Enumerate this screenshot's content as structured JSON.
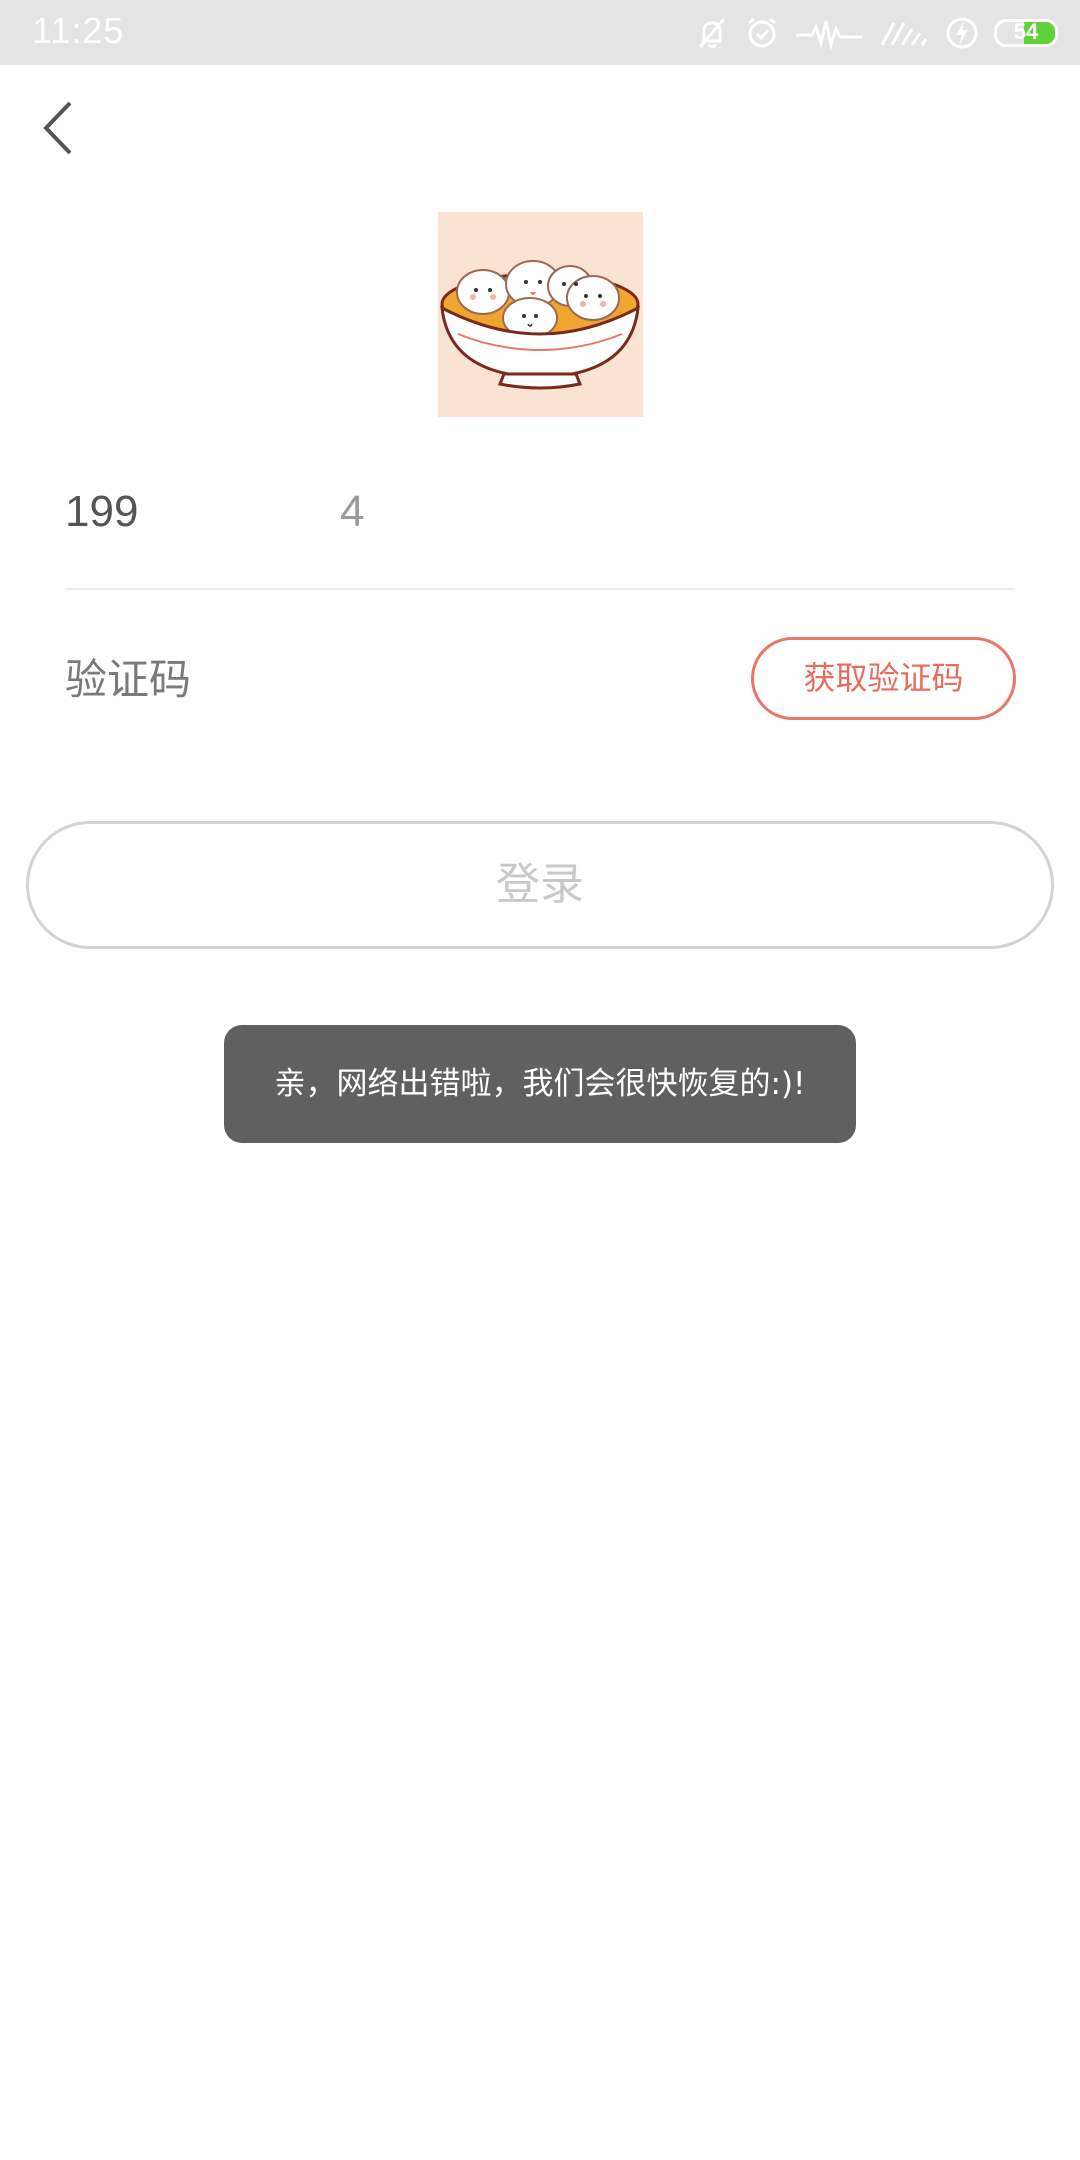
{
  "status_bar": {
    "time": "11:25",
    "battery_level": "54",
    "battery_fraction": 0.54,
    "battery_color": "#5fd23a",
    "icons": [
      "mute-icon",
      "alarm-icon",
      "activity-icon",
      "signal-icon",
      "charging-icon",
      "battery-icon"
    ]
  },
  "header": {
    "back_icon": "chevron-left-icon"
  },
  "logo": {
    "icon": "tangyuan-bowl-logo"
  },
  "login_form": {
    "phone_prefix": "199",
    "phone_suffix": "4",
    "code_placeholder": "验证码",
    "get_code_label": "获取验证码",
    "login_label": "登录"
  },
  "toast": {
    "message": "亲，网络出错啦，我们会很快恢复的:)!"
  },
  "colors": {
    "accent": "#e8776a",
    "toast_bg": "#606060"
  }
}
